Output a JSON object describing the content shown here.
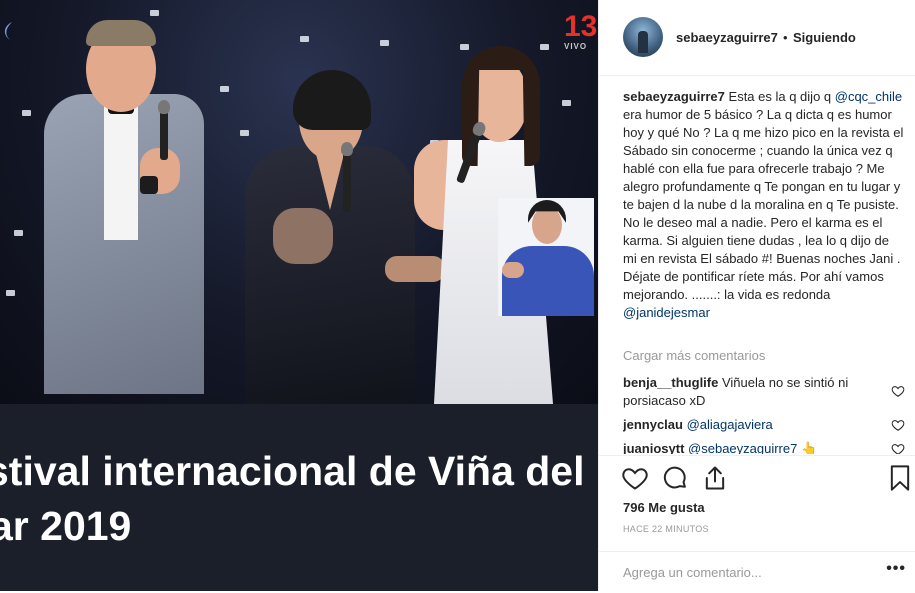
{
  "media": {
    "channel_logo": "13",
    "channel_logo_sub": "VIVO",
    "caption_line1": "stival internacional de Viña del",
    "caption_line2": "ar 2019"
  },
  "post": {
    "author": "sebaeyzaguirre7",
    "separator": "•",
    "follow_status": "Siguiendo",
    "caption": {
      "author": "sebaeyzaguirre7",
      "t1": " Esta es la q dijo q ",
      "m1": "@cqc_chile",
      "t2": " era humor de 5 básico ? La q dicta q es humor hoy y qué No ? La q me hizo pico en la revista el Sábado sin conocerme ; cuando la única vez q hablé con ella fue para ofrecerle trabajo ? Me alegro profundamente q Te pongan en tu lugar y te bajen d la nube d la moralina en q Te pusiste. No le deseo mal a nadie. Pero el karma es el karma. Si alguien tiene dudas , lea lo q dijo de mi en revista El sábado #! Buenas noches Jani . Déjate de pontificar ríete más. Por ahí vamos mejorando. .......: la vida es redonda ",
      "m2": "@janidejesmar"
    },
    "load_more": "Cargar más comentarios",
    "comments": [
      {
        "user": "benja__thuglife",
        "text": " Viñuela no se sintió ni porsiacaso xD",
        "mention": ""
      },
      {
        "user": "jennyclau",
        "text": " ",
        "mention": "@aliagajaviera"
      },
      {
        "user": "juaniosytt",
        "text": " ",
        "mention": "@sebaeyzaguirre7 👆"
      }
    ],
    "likes": "796 Me gusta",
    "time": "HACE 22 MINUTOS",
    "comment_placeholder": "Agrega un comentario...",
    "more_options": "•••"
  },
  "colors": {
    "mention": "#003569",
    "muted": "#999999",
    "text": "#262626",
    "channel_red": "#e4322b"
  },
  "icons": [
    "heart-icon",
    "comment-icon",
    "share-icon",
    "bookmark-icon",
    "small-heart-icon"
  ]
}
